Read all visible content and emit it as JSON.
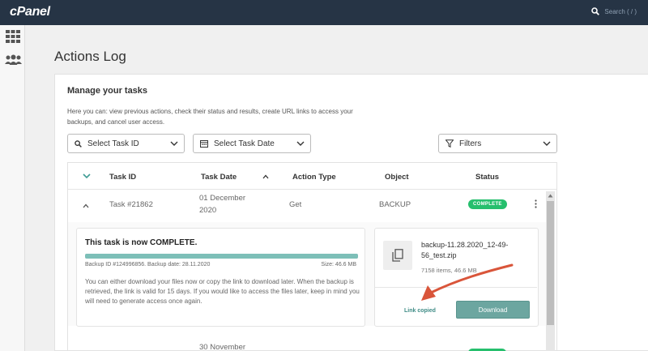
{
  "topbar": {
    "logo": "cPanel",
    "search_label": "Search ( / )"
  },
  "sidebar": {
    "icons": [
      "grid-icon",
      "users-icon"
    ]
  },
  "page_title": "Actions Log",
  "card": {
    "heading": "Manage your tasks",
    "description": "Here you can: view previous actions, check their status and results, create URL links to access your backups, and cancel user access."
  },
  "filters": {
    "task_id": "Select Task ID",
    "task_date": "Select Task Date",
    "filters": "Filters"
  },
  "table": {
    "headers": [
      "Task ID",
      "Task Date",
      "Action Type",
      "Object",
      "Status"
    ],
    "rows": [
      {
        "task_id": "Task #21862",
        "date_line1": "01 December",
        "date_line2": "2020",
        "action": "Get",
        "object": "BACKUP",
        "status": "COMPLETE"
      },
      {
        "date_line1": "30 November"
      }
    ]
  },
  "detail": {
    "title": "This task is now COMPLETE.",
    "progress": 1.0,
    "backup_info": "Backup ID #124996856. Backup date: 28.11.2020",
    "size_info": "Size: 46.6 MB",
    "text": "You can either download your files now or copy the link to download later. When the backup is retrieved, the link is valid for 15 days. If you would like to access the files later, keep in mind you will need to generate access once again.",
    "file_name": "backup-11.28.2020_12-49-56_test.zip",
    "file_stats": "7158 items, 46.6 MB",
    "link_copied": "Link copied",
    "download": "Download"
  },
  "colors": {
    "topbar": "#263445",
    "complete": "#26bf6d",
    "accent": "#6ca6a0",
    "arrow": "#d9553a"
  }
}
